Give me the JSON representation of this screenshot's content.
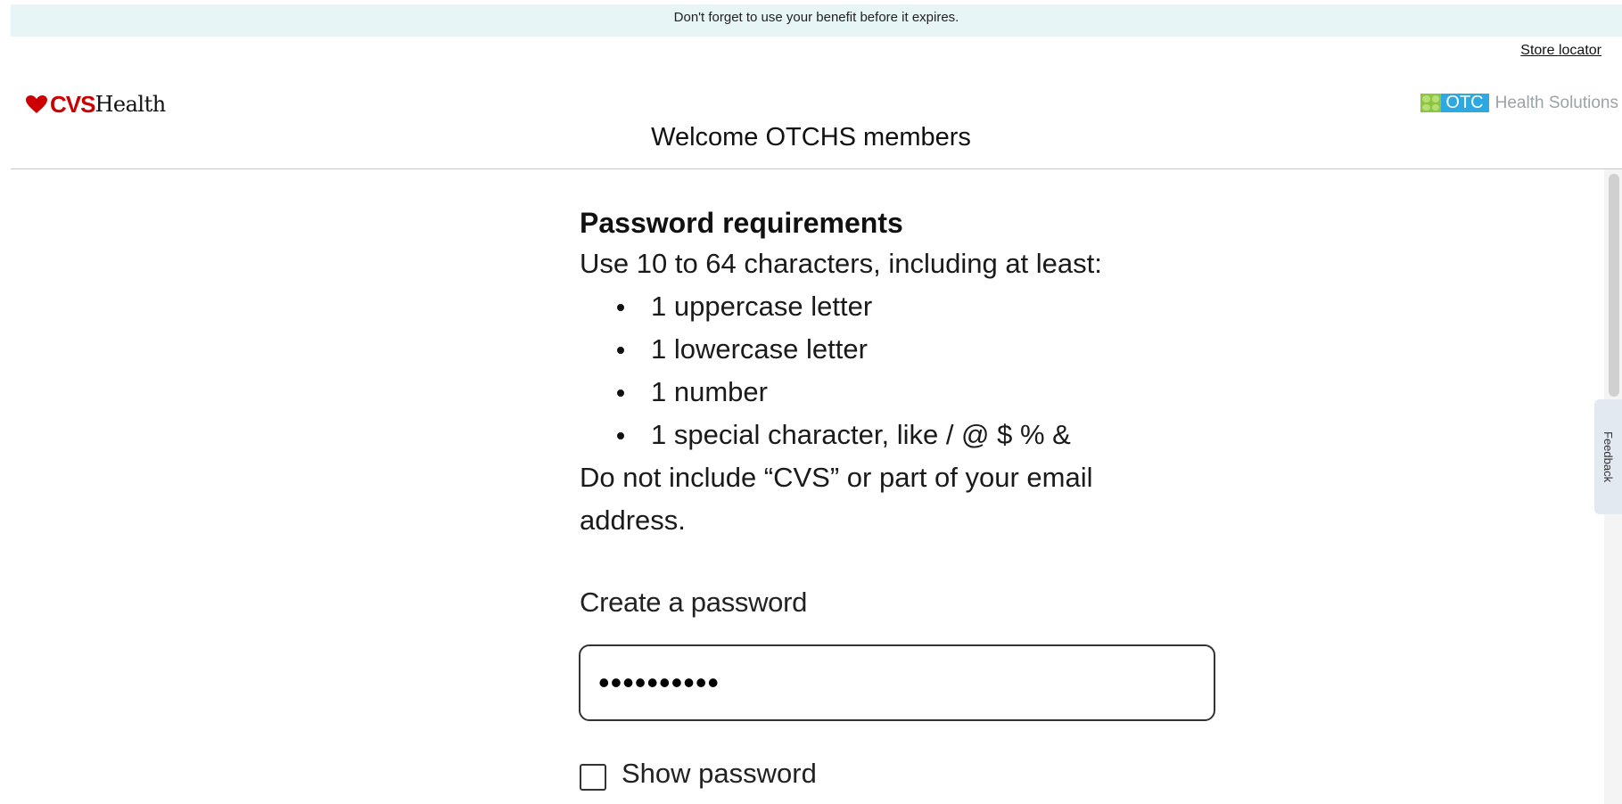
{
  "banner": {
    "text": "Don't forget to use your benefit before it expires."
  },
  "header": {
    "store_locator": "Store locator",
    "cvs_logo": {
      "brand": "CVS",
      "suffix": "Health"
    },
    "partner_logo": {
      "badge": "OTC",
      "name": "Health Solutions"
    },
    "welcome": "Welcome OTCHS members"
  },
  "requirements": {
    "title": "Password requirements",
    "intro": "Use 10 to 64 characters, including at least:",
    "items": [
      "1 uppercase letter",
      "1 lowercase letter",
      "1 number",
      "1 special character, like / @ $ % &"
    ],
    "note": "Do not include “CVS” or part of your email address."
  },
  "form": {
    "password_label": "Create a password",
    "password_value": "••••••••••",
    "show_password_label": "Show password",
    "show_password_checked": false
  },
  "feedback": {
    "label": "Feedback"
  },
  "colors": {
    "banner_bg": "#e7f5f7",
    "cvs_red": "#cc0000",
    "otc_blue": "#2da8e0",
    "otc_green": "#8cc63f"
  }
}
